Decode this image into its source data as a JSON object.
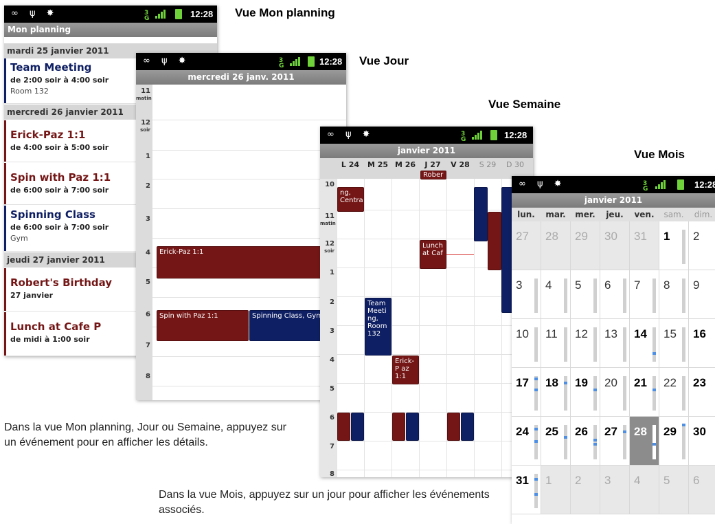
{
  "captions": {
    "agenda": "Vue Mon planning",
    "day": "Vue Jour",
    "week": "Vue Semaine",
    "month": "Vue Mois"
  },
  "notes": {
    "tap_event": "Dans la vue Mon planning, Jour ou Semaine, appuyez sur un événement pour en afficher les détails.",
    "tap_day": "Dans la vue Mois, appuyez sur un jour pour afficher les événements associés."
  },
  "status": {
    "time": "12:28",
    "network": "3G"
  },
  "colors": {
    "event_red": "#741616",
    "event_blue": "#0f1f63",
    "today_grey": "#8c8c8c",
    "event_mark_blue": "#4f8fe3"
  },
  "agenda": {
    "title": "Mon planning",
    "days": [
      {
        "label": "mardi 25 janvier 2011",
        "events": [
          {
            "title": "Team Meeting",
            "when": "de 2:00 soir à 4:00 soir",
            "where": "Room 132",
            "color": "blue"
          }
        ]
      },
      {
        "label": "mercredi 26 janvier 2011",
        "events": [
          {
            "title": "Erick-Paz 1:1",
            "when": "de 4:00 soir à 5:00 soir",
            "where": "",
            "color": "red"
          },
          {
            "title": "Spin with Paz 1:1",
            "when": "de 6:00 soir à 7:00 soir",
            "where": "",
            "color": "red"
          },
          {
            "title": "Spinning Class",
            "when": "de 6:00 soir à 7:00 soir",
            "where": "Gym",
            "color": "blue"
          }
        ]
      },
      {
        "label": "jeudi 27 janvier 2011",
        "events": [
          {
            "title": "Robert's Birthday",
            "when": "27 janvier",
            "where": "",
            "color": "red"
          },
          {
            "title": "Lunch at Cafe P",
            "when": "de midi à 1:00 soir",
            "where": "",
            "color": "red"
          }
        ]
      }
    ]
  },
  "day": {
    "title": "mercredi 26 janv. 2011",
    "hours": [
      {
        "label": "11",
        "sub": "matin"
      },
      {
        "label": "12",
        "sub": "soir"
      },
      {
        "label": "1",
        "sub": ""
      },
      {
        "label": "2",
        "sub": ""
      },
      {
        "label": "3",
        "sub": ""
      },
      {
        "label": "4",
        "sub": ""
      },
      {
        "label": "5",
        "sub": ""
      },
      {
        "label": "6",
        "sub": ""
      },
      {
        "label": "7",
        "sub": ""
      },
      {
        "label": "8",
        "sub": ""
      }
    ],
    "events": {
      "erick": "Erick-Paz 1:1",
      "spin": "Spin with Paz 1:1",
      "spinning": "Spinning Class, Gym"
    }
  },
  "week": {
    "title": "janvier 2011",
    "days": [
      "L 24",
      "M 25",
      "M 26",
      "J 27",
      "V 28",
      "S 29",
      "D 30"
    ],
    "allday": "Rober",
    "hours": [
      {
        "label": "10",
        "sub": ""
      },
      {
        "label": "11",
        "sub": "matin"
      },
      {
        "label": "12",
        "sub": "soir"
      },
      {
        "label": "1",
        "sub": ""
      },
      {
        "label": "2",
        "sub": ""
      },
      {
        "label": "3",
        "sub": ""
      },
      {
        "label": "4",
        "sub": ""
      },
      {
        "label": "5",
        "sub": ""
      },
      {
        "label": "6",
        "sub": ""
      },
      {
        "label": "7",
        "sub": ""
      },
      {
        "label": "8",
        "sub": ""
      }
    ],
    "events": {
      "central": "ng, Centra",
      "lunch": "Lunch at Caf",
      "team": "Team Meeti ng, Room 132",
      "erick": "Erick-P az 1:1"
    }
  },
  "month": {
    "title": "janvier 2011",
    "dow": [
      "lun.",
      "mar.",
      "mer.",
      "jeu.",
      "ven.",
      "sam.",
      "dim."
    ],
    "weeks": [
      [
        "27",
        "28",
        "29",
        "30",
        "31",
        "1",
        "2"
      ],
      [
        "3",
        "4",
        "5",
        "6",
        "7",
        "8",
        "9"
      ],
      [
        "10",
        "11",
        "12",
        "13",
        "14",
        "15",
        "16"
      ],
      [
        "17",
        "18",
        "19",
        "20",
        "21",
        "22",
        "23"
      ],
      [
        "24",
        "25",
        "26",
        "27",
        "28",
        "29",
        "30"
      ],
      [
        "31",
        "1",
        "2",
        "3",
        "4",
        "5",
        "6"
      ]
    ],
    "today": "28"
  }
}
